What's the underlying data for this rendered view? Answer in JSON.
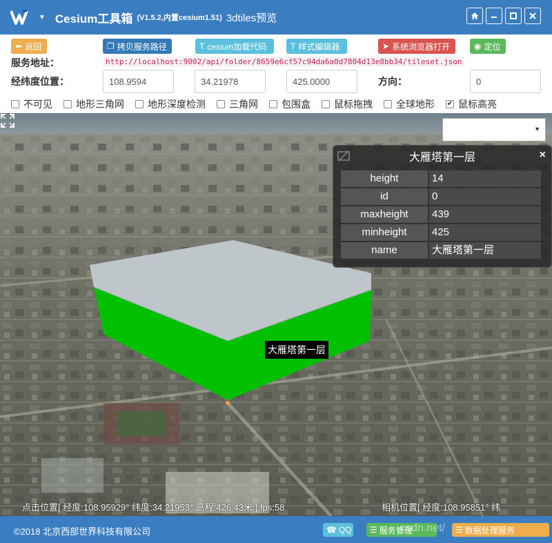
{
  "app": {
    "title": "Cesium工具箱",
    "version": "(V1.5.2,内置cesium1.51)",
    "subtitle": "3dtiles预览"
  },
  "toolbar": {
    "back_label": "返回",
    "copy_label": "拷贝服务路径",
    "cesium_code_label": "cesium加载代码",
    "style_editor_label": "样式编辑器",
    "browser_open_label": "系统浏览器打开",
    "locate_label": "定位",
    "service_url_label": "服务地址：",
    "service_url": "http://localhost:9002/api/folder/8659e6cf57c94da6a0d7804d13e8bb34/tileset.json",
    "position_label": "经纬度位置：",
    "longitude": "108.9594",
    "latitude": "34.21978",
    "altitude": "425.0000",
    "direction_label": "方向：",
    "direction": "0"
  },
  "options": [
    {
      "label": "不可见",
      "checked": false
    },
    {
      "label": "地形三角网",
      "checked": false
    },
    {
      "label": "地形深度检测",
      "checked": false
    },
    {
      "label": "三角网",
      "checked": false
    },
    {
      "label": "包围盒",
      "checked": false
    },
    {
      "label": "鼠标拖拽",
      "checked": false
    },
    {
      "label": "全球地形",
      "checked": false
    },
    {
      "label": "鼠标高亮",
      "checked": true
    }
  ],
  "info_panel": {
    "title": "大雁塔第一层",
    "rows": [
      {
        "key": "height",
        "value": "14"
      },
      {
        "key": "id",
        "value": "0"
      },
      {
        "key": "maxheight",
        "value": "439"
      },
      {
        "key": "minheight",
        "value": "425"
      },
      {
        "key": "name",
        "value": "大雁塔第一层"
      }
    ]
  },
  "map": {
    "feature_label": "大雁塔第一层",
    "click_status": "点击位置[ 经度:108.95929° 纬度:34.21953° 高程:426.43米 ] fps:58",
    "camera_status": "相机位置[ 经度:108.95851° 纬",
    "highlight_color": "#00c000",
    "top_color": "#bfc6ca"
  },
  "footer": {
    "copyright": "©2018 北京西部世界科技有限公司",
    "qq_label": "QQ",
    "service_mgmt_label": "服务管理",
    "data_process_label": "数据处理服务",
    "watermark": "csdn.net/"
  },
  "colors": {
    "primary": "#3a7dc0",
    "warning": "#f0ad4e",
    "info": "#5bc0de",
    "danger": "#d9534f",
    "success": "#5cb85c"
  }
}
